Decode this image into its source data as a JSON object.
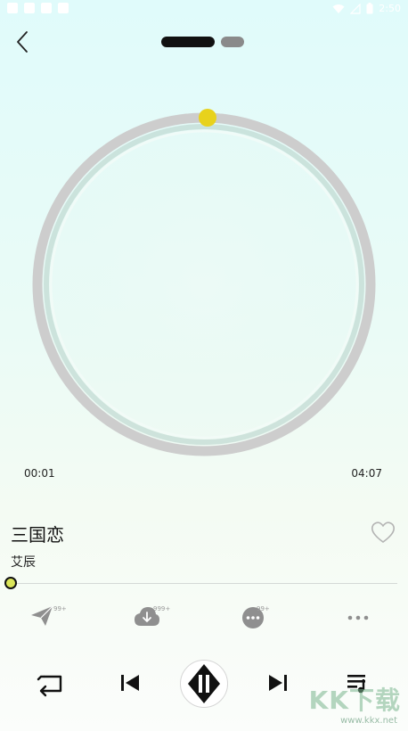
{
  "status_bar": {
    "time": "2:50"
  },
  "header": {
    "back_icon": "chevron-left-icon",
    "page_indicator": {
      "count": 2,
      "active_index": 0
    }
  },
  "player": {
    "current_time": "00:01",
    "total_time": "04:07",
    "progress_fraction": 0.004
  },
  "song": {
    "title": "三国恋",
    "artist": "艾辰",
    "favorite": false
  },
  "actions": [
    {
      "name": "share-icon",
      "badge": "99+"
    },
    {
      "name": "download-icon",
      "badge": "999+"
    },
    {
      "name": "comment-icon",
      "badge": "99+"
    },
    {
      "name": "more-icon",
      "badge": ""
    }
  ],
  "controls": {
    "repeat": "repeat-icon",
    "previous": "previous-icon",
    "play_pause": "pause-icon",
    "next": "next-icon",
    "playlist": "playlist-icon"
  },
  "colors": {
    "accent": "#e8d21c",
    "ring": "#cdcdcd",
    "text": "#222222"
  },
  "watermark": {
    "text": "KK下载",
    "url": "www.kkx.net"
  }
}
